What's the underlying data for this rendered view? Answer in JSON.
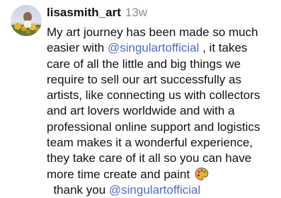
{
  "comment": {
    "username": "lisasmith_art",
    "timestamp": "13w",
    "text_1": "My art journey has been made so much easier with ",
    "mention_1": "@singulartofficial",
    "text_2": " , it takes care of all the little and big things we require to sell our art successfully as artists, like connecting us with collectors and art lovers worldwide and with a professional online support and logistics team makes it a wonderful experience, they take care of it all so you can have more time create and paint ",
    "emoji": "artist-palette-icon",
    "text_3": "  thank you ",
    "mention_2": "@singulartofficial"
  },
  "colors": {
    "mention": "#4d6bd1",
    "timestamp": "#8e8e8e",
    "text": "#111111"
  }
}
